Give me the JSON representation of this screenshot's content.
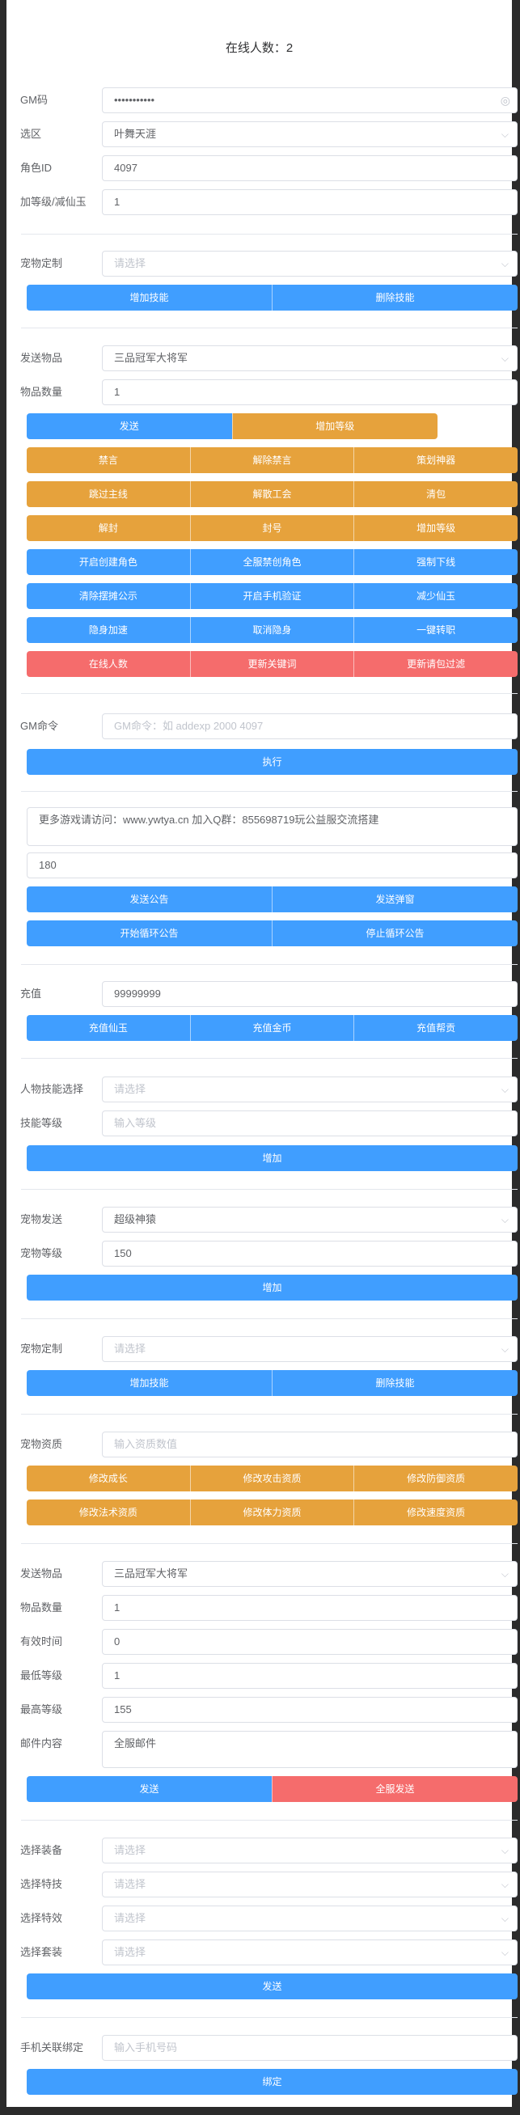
{
  "header": {
    "title": "在线人数：2"
  },
  "gm": {
    "gm_code_label": "GM码",
    "gm_code_value": "•••••••••••",
    "server_label": "选区",
    "server_value": "叶舞天涯",
    "role_id_label": "角色ID",
    "role_id_value": "4097",
    "level_label": "加等级/减仙玉",
    "level_value": "1"
  },
  "pet_custom1": {
    "label": "宠物定制",
    "placeholder": "请选择",
    "buttons": [
      "增加技能",
      "删除技能"
    ]
  },
  "send_item": {
    "item_label": "发送物品",
    "item_value": "三品冠军大将军",
    "qty_label": "物品数量",
    "qty_value": "1",
    "send_label": "发送",
    "add_level_label": "增加等级"
  },
  "grid_rows": [
    [
      "禁言",
      "解除禁言",
      "策划神器"
    ],
    [
      "跳过主线",
      "解散工会",
      "清包"
    ],
    [
      "解封",
      "封号",
      "增加等级"
    ],
    [
      "开启创建角色",
      "全服禁创角色",
      "强制下线"
    ],
    [
      "清除摆摊公示",
      "开启手机验证",
      "减少仙玉"
    ],
    [
      "隐身加速",
      "取消隐身",
      "一键转职"
    ],
    [
      "在线人数",
      "更新关键词",
      "更新请包过滤"
    ]
  ],
  "gm_cmd": {
    "label": "GM命令",
    "placeholder": "GM命令：如 addexp 2000 4097",
    "exec_label": "执行"
  },
  "notice": {
    "text": "更多游戏请访问：www.ywtya.cn  加入Q群：855698719玩公益服交流搭建",
    "interval": "180",
    "buttons1": [
      "发送公告",
      "发送弹窗"
    ],
    "buttons2": [
      "开始循环公告",
      "停止循环公告"
    ]
  },
  "recharge": {
    "label": "充值",
    "value": "99999999",
    "buttons": [
      "充值仙玉",
      "充值金币",
      "充值帮贡"
    ]
  },
  "skill": {
    "skill_label": "人物技能选择",
    "skill_placeholder": "请选择",
    "level_label": "技能等级",
    "level_placeholder": "输入等级",
    "add_label": "增加"
  },
  "pet_send": {
    "label": "宠物发送",
    "value": "超级神猿",
    "level_label": "宠物等级",
    "level_value": "150",
    "add_label": "增加"
  },
  "pet_custom2": {
    "label": "宠物定制",
    "placeholder": "请选择",
    "buttons": [
      "增加技能",
      "删除技能"
    ]
  },
  "pet_aptitude": {
    "label": "宠物资质",
    "placeholder": "输入资质数值",
    "buttons1": [
      "修改成长",
      "修改攻击资质",
      "修改防御资质"
    ],
    "buttons2": [
      "修改法术资质",
      "修改体力资质",
      "修改速度资质"
    ]
  },
  "mail": {
    "item_label": "发送物品",
    "item_value": "三品冠军大将军",
    "qty_label": "物品数量",
    "qty_value": "1",
    "valid_label": "有效时间",
    "valid_value": "0",
    "min_label": "最低等级",
    "min_value": "1",
    "max_label": "最高等级",
    "max_value": "155",
    "content_label": "邮件内容",
    "content_value": "全服邮件",
    "send_label": "发送",
    "send_all_label": "全服发送"
  },
  "equip": {
    "equip_label": "选择装备",
    "trick_label": "选择特技",
    "effect_label": "选择特效",
    "set_label": "选择套装",
    "placeholder": "请选择",
    "send_label": "发送"
  },
  "phone": {
    "label": "手机关联绑定",
    "placeholder": "输入手机号码",
    "bind_label": "绑定"
  },
  "colors": {
    "primary": "#409eff",
    "warning": "#e6a23c",
    "danger": "#f56c6c",
    "border": "#dcdfe6",
    "placeholder": "#c0c4cc"
  }
}
